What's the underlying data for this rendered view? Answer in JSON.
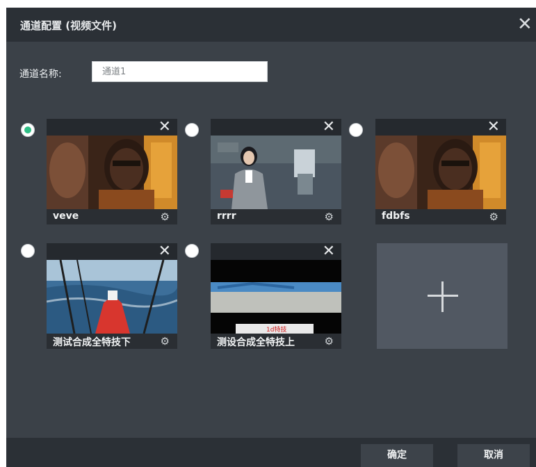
{
  "dialog": {
    "title": "通道配置 (视频文件)",
    "close_icon": "close-icon"
  },
  "channel_name": {
    "label": "通道名称:",
    "value": "",
    "placeholder": "通道1"
  },
  "videos": [
    {
      "name": "veve",
      "selected": true
    },
    {
      "name": "rrrr",
      "selected": false
    },
    {
      "name": "fdbfs",
      "selected": false
    },
    {
      "name": "测试合成全特技下",
      "selected": false
    },
    {
      "name": "测设合成全特技上",
      "selected": false
    }
  ],
  "thumb_overlay_text": "1d特技",
  "add_tile": {
    "icon": "plus-icon"
  },
  "footer": {
    "confirm_label": "确定",
    "cancel_label": "取消"
  },
  "colors": {
    "dialog_bg": "#3b4148",
    "titlebar_bg": "#2b3036",
    "selected_radio": "#2fbe86",
    "add_tile_bg": "#515862"
  }
}
